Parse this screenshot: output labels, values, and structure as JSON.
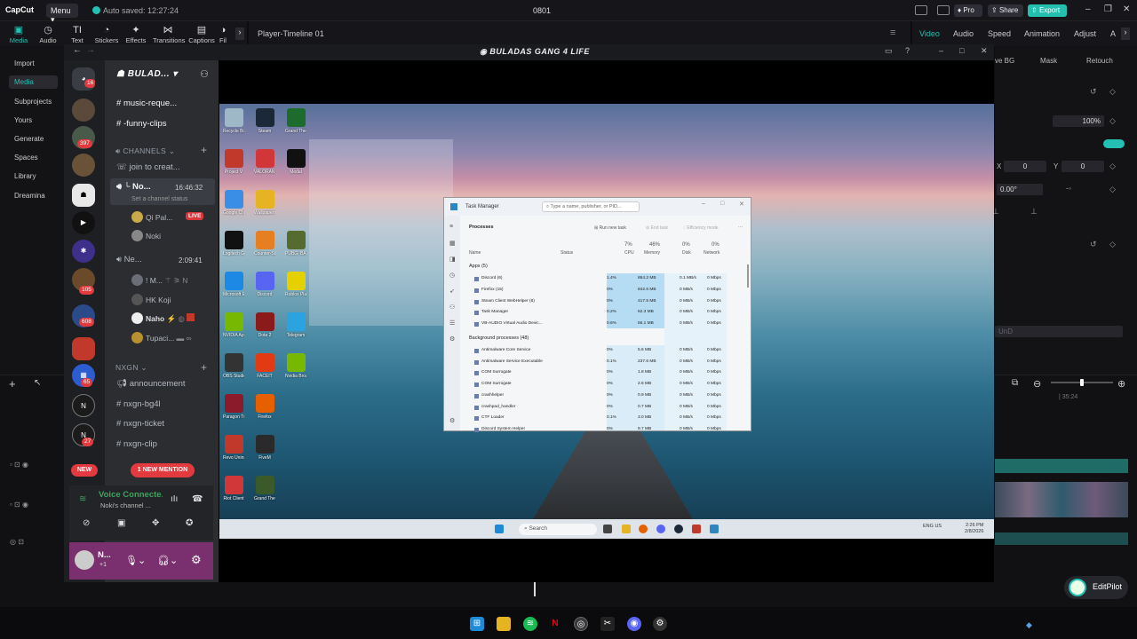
{
  "app": {
    "logo": "CapCut",
    "menu": "Menu",
    "autosave": "Auto saved: 12:27:24",
    "project": "0801",
    "pro": "Pro",
    "share": "Share",
    "export": "Export"
  },
  "toolbar": [
    {
      "label": "Media",
      "icon": "media-icon",
      "active": true
    },
    {
      "label": "Audio",
      "icon": "audio-icon"
    },
    {
      "label": "Text",
      "icon": "text-icon"
    },
    {
      "label": "Stickers",
      "icon": "sticker-icon"
    },
    {
      "label": "Effects",
      "icon": "effects-icon"
    },
    {
      "label": "Transitions",
      "icon": "transitions-icon"
    },
    {
      "label": "Captions",
      "icon": "captions-icon"
    },
    {
      "label": "Fil",
      "icon": "filters-icon"
    }
  ],
  "player": {
    "title": "Player-Timeline 01"
  },
  "right_tabs": [
    "Video",
    "Audio",
    "Speed",
    "Animation",
    "Adjust",
    "A"
  ],
  "right_panel": {
    "subtabs": [
      "ve BG",
      "Mask",
      "Retouch"
    ],
    "scale": "100%",
    "pos_x": "0",
    "pos_y": "0",
    "rotate": "0.00°",
    "x_label": "X",
    "y_label": "Y",
    "blend": "UnD"
  },
  "left_nav": [
    "Import",
    "Media",
    "Subprojects",
    "Yours",
    "Generate",
    "Spaces",
    "Library",
    "Dreamina"
  ],
  "timeline": {
    "duration": "| 35:24"
  },
  "discord": {
    "window_title": "BULADAS GANG 4 LIFE",
    "server": "BULAD...",
    "guild_badges": [
      "16",
      "397",
      "105",
      "608",
      "65",
      "27"
    ],
    "top_channels": [
      "music-reque...",
      "-funny-clips"
    ],
    "category1": "CHANNELS",
    "create": "join to creat...",
    "voice1": {
      "name": "No...",
      "time": "16:46:32",
      "status": "Set a channel status"
    },
    "voice1_users": [
      "Qi Pal...",
      "Noki"
    ],
    "live": "LIVE",
    "voice2": {
      "name": "Ne...",
      "time": "2:09:41"
    },
    "voice2_users": [
      "! M...",
      "HK Koji",
      "Naho",
      "Tupaci..."
    ],
    "category2": "NXGN",
    "nxgn_channels": [
      "announcement",
      "nxgn-bg4l",
      "nxgn-ticket",
      "nxgn-clip"
    ],
    "new": "NEW",
    "mention": "1 NEW MENTION",
    "voice_connected": "Voice Connecte...",
    "voice_sub": "Noki's channel ...",
    "user": "N...",
    "user_sub": "+1"
  },
  "desktop": {
    "icons": [
      [
        "Recycle Bin",
        "Steam",
        "Grand Theft Auto V Enh..."
      ],
      [
        "Project V",
        "VALORANT",
        "Medal"
      ],
      [
        "Google Chrome",
        "Wallpapers",
        ""
      ],
      [
        "Logitech G HUB",
        "Counter-Strike 2",
        "PUBG: BATTLEGR..."
      ],
      [
        "Microsoft Edge",
        "Discord",
        "Roblox Player"
      ],
      [
        "NVIDIA App",
        "Dota 2",
        "Telegram"
      ],
      [
        "OBS Studio",
        "FACEIT",
        "Nvidia Broadcast"
      ],
      [
        "Paragon Tweaks",
        "Firefox",
        ""
      ],
      [
        "Revo Uninstaller",
        "FiveM",
        ""
      ],
      [
        "Riot Client",
        "Grand Theft Auto V En...",
        ""
      ]
    ],
    "search": "Search",
    "lang": "ENG US",
    "time": "2:26 PM",
    "date": "2/8/2026"
  },
  "task_manager": {
    "title": "Task Manager",
    "search": "Type a name, publisher, or PID...",
    "section": "Processes",
    "run": "Run new task",
    "end": "End task",
    "eff": "Efficiency mode",
    "cols": [
      "Name",
      "Status",
      "CPU",
      "Memory",
      "Disk",
      "Network"
    ],
    "pct": [
      "7%",
      "46%",
      "0%",
      "0%"
    ],
    "apps_header": "Apps (5)",
    "apps": [
      [
        "Discord (6)",
        "1.4%",
        "864.2 MB",
        "0.1 MB/s",
        "0 Mbps"
      ],
      [
        "Firefox (15)",
        "0%",
        "842.6 MB",
        "0 MB/s",
        "0 Mbps"
      ],
      [
        "Steam Client WebHelper (8)",
        "0%",
        "417.5 MB",
        "0 MB/s",
        "0 Mbps"
      ],
      [
        "Task Manager",
        "0.2%",
        "62.3 MB",
        "0 MB/s",
        "0 Mbps"
      ],
      [
        "VB-AUDIO Virtual Audio Devic...",
        "0.6%",
        "56.1 MB",
        "0 MB/s",
        "0 Mbps"
      ]
    ],
    "bg_header": "Background processes (48)",
    "bg": [
      [
        "Antimalware Core Service",
        "0%",
        "5.6 MB",
        "0 MB/s",
        "0 Mbps"
      ],
      [
        "Antimalware Service Executable",
        "0.1%",
        "237.6 MB",
        "0 MB/s",
        "0 Mbps"
      ],
      [
        "COM Surrogate",
        "0%",
        "1.8 MB",
        "0 MB/s",
        "0 Mbps"
      ],
      [
        "COM Surrogate",
        "0%",
        "2.6 MB",
        "0 MB/s",
        "0 Mbps"
      ],
      [
        "crashhelper",
        "0%",
        "0.9 MB",
        "0 MB/s",
        "0 Mbps"
      ],
      [
        "crashpad_handler",
        "0%",
        "0.7 MB",
        "0 MB/s",
        "0 Mbps"
      ],
      [
        "CTF Loader",
        "0.1%",
        "3.0 MB",
        "0 MB/s",
        "0 Mbps"
      ],
      [
        "Discord System Helper",
        "0%",
        "9.7 MB",
        "0 MB/s",
        "0 Mbps"
      ]
    ]
  },
  "editpilot": "EditPilot"
}
